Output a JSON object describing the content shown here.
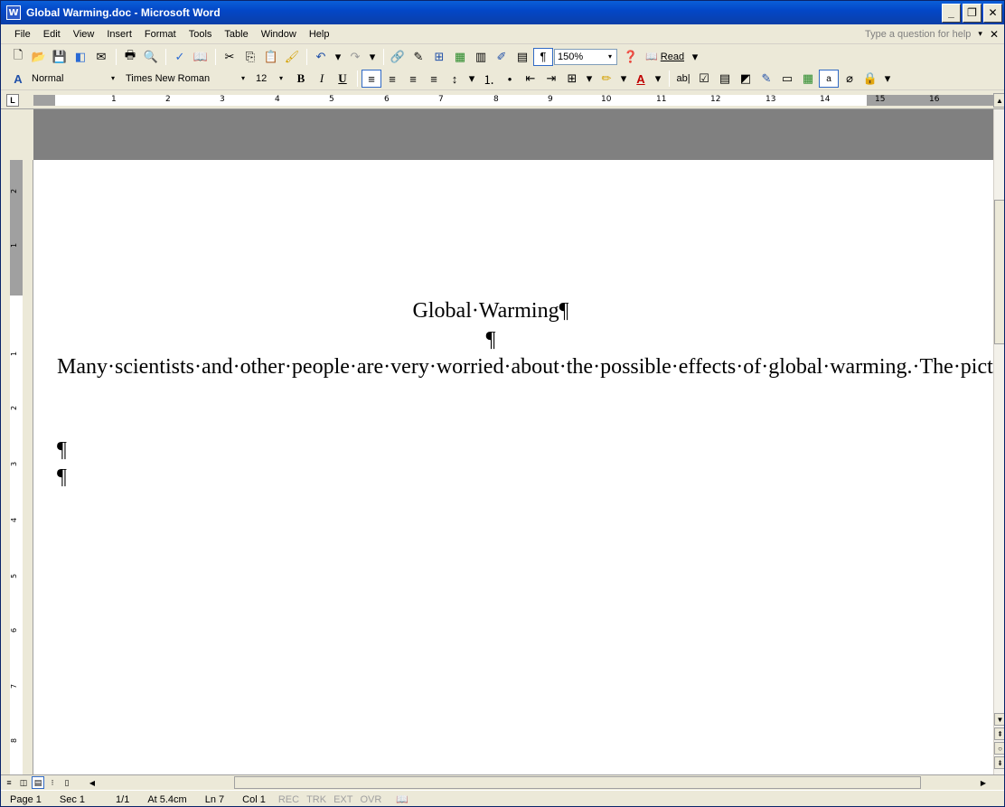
{
  "window": {
    "title": "Global Warming.doc - Microsoft Word",
    "app_icon": "W",
    "minimize": "_",
    "restore": "❐",
    "close": "✕"
  },
  "menu": {
    "items": [
      "File",
      "Edit",
      "View",
      "Insert",
      "Format",
      "Tools",
      "Table",
      "Window",
      "Help"
    ],
    "help_box": "Type a question for help",
    "help_dropdown": "▾",
    "doc_close": "✕"
  },
  "toolbar_standard": {
    "zoom": "150%",
    "read_label": "Read",
    "show_hide": "¶"
  },
  "toolbar_formatting": {
    "style": "Normal",
    "font": "Times New Roman",
    "size": "12",
    "bold": "B",
    "italic": "I",
    "underline": "U"
  },
  "ruler": {
    "tab_selector": "L",
    "ticks": [
      "1",
      "2",
      "3",
      "4",
      "5",
      "6",
      "7",
      "8",
      "9",
      "10",
      "11",
      "12",
      "13",
      "14",
      "15",
      "16"
    ]
  },
  "vruler": {
    "ticks": [
      "2",
      "1",
      "1",
      "2",
      "3",
      "4",
      "5",
      "6",
      "7",
      "8"
    ]
  },
  "document": {
    "title": "Global·Warming¶",
    "empty_para": "¶",
    "paragraph": "Many·scientists·and·other·people·are·very·worried·about·the·possible·effects·of·global·warming.·The·picture·below·is·one·expert’s·idea·of·how·a·rise·in·the·sea·level·might·affect·the·Australian·coastline.·¶",
    "empty_para2": "¶",
    "empty_para3": "¶"
  },
  "status": {
    "page": "Page 1",
    "section": "Sec 1",
    "pages": "1/1",
    "at": "At 5.4cm",
    "line": "Ln 7",
    "col": "Col 1",
    "rec": "REC",
    "trk": "TRK",
    "ext": "EXT",
    "ovr": "OVR"
  }
}
